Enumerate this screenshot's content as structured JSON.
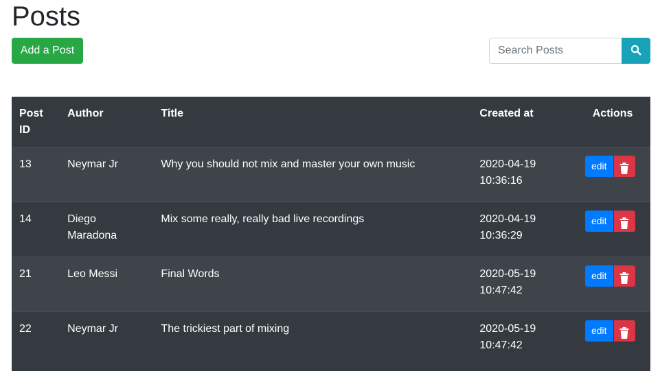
{
  "page": {
    "title": "Posts"
  },
  "toolbar": {
    "add_label": "Add a Post",
    "search_placeholder": "Search Posts",
    "search_icon": "search-icon"
  },
  "table": {
    "headers": {
      "id": "Post ID",
      "author": "Author",
      "title": "Title",
      "created": "Created at",
      "actions": "Actions"
    },
    "rows": [
      {
        "id": "13",
        "author": "Neymar Jr",
        "title": "Why you should not mix and master your own music",
        "created": "2020-04-19 10:36:16",
        "edit_label": "edit",
        "delete_icon": "trash-icon"
      },
      {
        "id": "14",
        "author": "Diego Maradona",
        "title": "Mix some really, really bad live recordings",
        "created": "2020-04-19 10:36:29",
        "edit_label": "edit",
        "delete_icon": "trash-icon"
      },
      {
        "id": "21",
        "author": "Leo Messi",
        "title": "Final Words",
        "created": "2020-05-19 10:47:42",
        "edit_label": "edit",
        "delete_icon": "trash-icon"
      },
      {
        "id": "22",
        "author": "Neymar Jr",
        "title": "The trickiest part of mixing",
        "created": "2020-05-19 10:47:42",
        "edit_label": "edit",
        "delete_icon": "trash-icon"
      }
    ]
  },
  "colors": {
    "add_button": "#28a745",
    "search_button": "#17a2b8",
    "edit_button": "#007bff",
    "delete_button": "#dc3545",
    "table_dark": "#343a40"
  }
}
